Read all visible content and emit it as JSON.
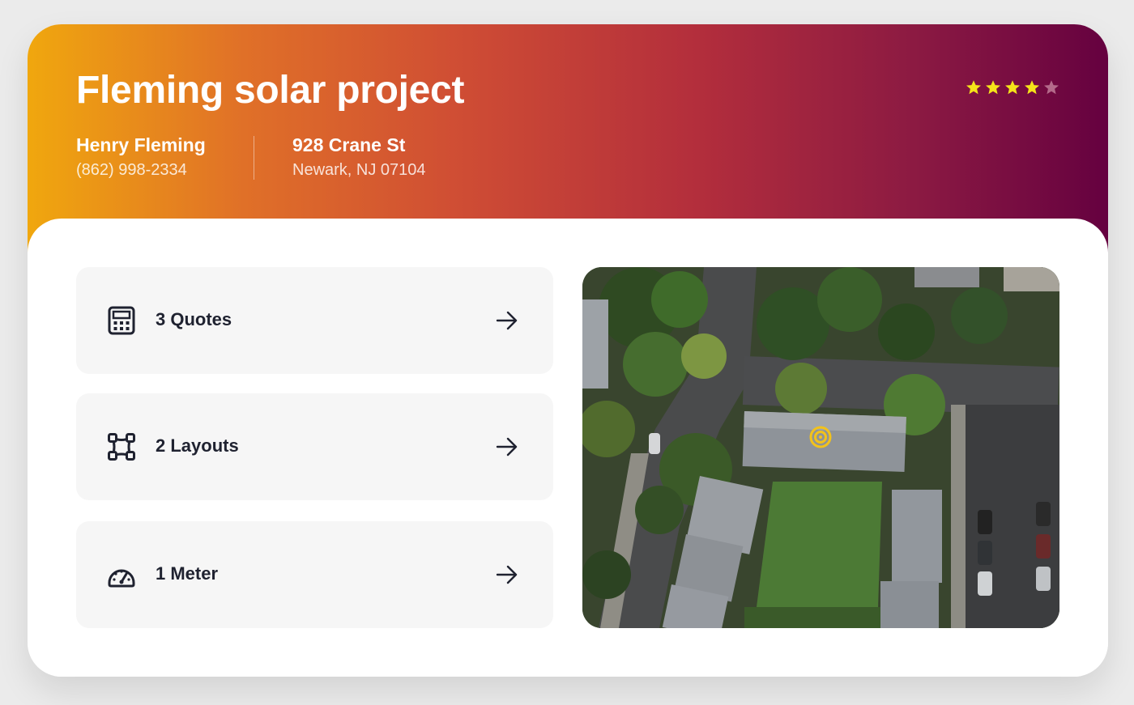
{
  "project": {
    "title": "Fleming solar project",
    "rating": 4,
    "rating_max": 5
  },
  "contact": {
    "name": "Henry Fleming",
    "phone": "(862) 998-2334"
  },
  "address": {
    "street": "928 Crane St",
    "city_line": "Newark, NJ 07104"
  },
  "tiles": [
    {
      "label": "3 Quotes",
      "icon": "calculator-icon"
    },
    {
      "label": "2 Layouts",
      "icon": "layout-icon"
    },
    {
      "label": "1 Meter",
      "icon": "meter-icon"
    }
  ],
  "map": {
    "type": "satellite",
    "marker": "location-marker-icon"
  },
  "colors": {
    "gradient_start": "#f0a70e",
    "gradient_end": "#650140",
    "star_active": "#f5e419",
    "star_inactive": "#b46a8a",
    "marker": "#f2c21b",
    "text_dark": "#1f2230"
  }
}
